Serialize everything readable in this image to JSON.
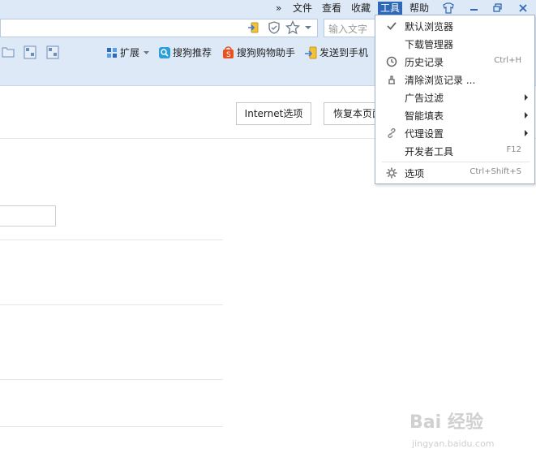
{
  "menubar": {
    "chevron": "»",
    "items": [
      "文件",
      "查看",
      "收藏",
      "工具",
      "帮助"
    ],
    "active_index": 3
  },
  "window_controls": {
    "skin": "skin-icon",
    "minimize": "minimize-icon",
    "restore": "restore-icon",
    "close": "close-icon"
  },
  "addressbar": {
    "search_placeholder": "输入文字"
  },
  "toolbar": {
    "extensions": "扩展",
    "sogou_recommend": "搜狗推荐",
    "shopping_assistant": "搜狗购物助手",
    "send_to_phone": "发送到手机"
  },
  "content": {
    "internet_options": "Internet选项",
    "restore_page": "恢复本页面"
  },
  "dropdown": {
    "items": [
      {
        "label": "默认浏览器",
        "shortcut": "",
        "icon": "check-icon",
        "submenu": false
      },
      {
        "label": "下载管理器",
        "shortcut": "",
        "icon": "",
        "submenu": false
      },
      {
        "label": "历史记录",
        "shortcut": "Ctrl+H",
        "icon": "clock-icon",
        "submenu": false
      },
      {
        "label": "清除浏览记录 ...",
        "shortcut": "",
        "icon": "eraser-icon",
        "submenu": false
      },
      {
        "label": "广告过滤",
        "shortcut": "",
        "icon": "",
        "submenu": true
      },
      {
        "label": "智能填表",
        "shortcut": "",
        "icon": "",
        "submenu": true
      },
      {
        "label": "代理设置",
        "shortcut": "",
        "icon": "link-icon",
        "submenu": true
      },
      {
        "label": "开发者工具",
        "shortcut": "F12",
        "icon": "",
        "submenu": false
      },
      {
        "label": "选项",
        "shortcut": "Ctrl+Shift+S",
        "icon": "gear-icon",
        "submenu": false
      }
    ]
  },
  "watermark": {
    "brand": "Bai 经验",
    "url": "jingyan.baidu.com"
  }
}
